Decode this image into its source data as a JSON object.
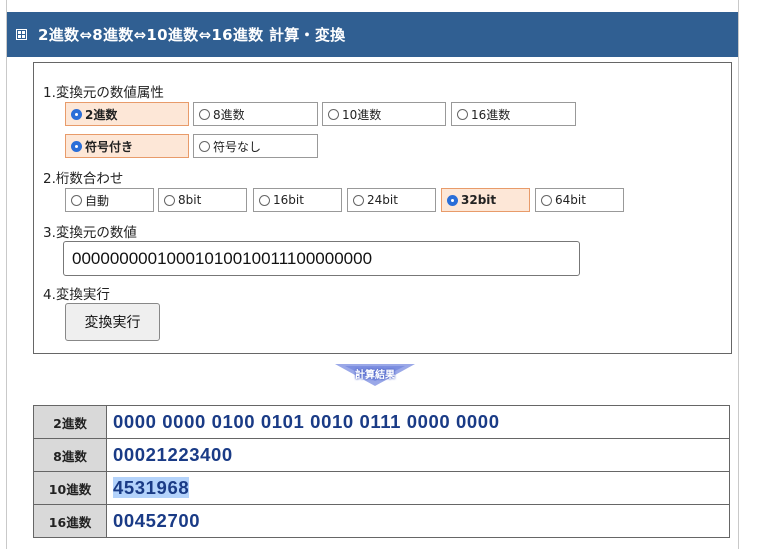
{
  "header": {
    "title": "2進数⇔8進数⇔10進数⇔16進数 計算・変換"
  },
  "form": {
    "step1": {
      "label": "1.変換元の数値属性",
      "base_options": [
        {
          "label": "2進数",
          "selected": true
        },
        {
          "label": "8進数",
          "selected": false
        },
        {
          "label": "10進数",
          "selected": false
        },
        {
          "label": "16進数",
          "selected": false
        }
      ],
      "sign_options": [
        {
          "label": "符号付き",
          "selected": true
        },
        {
          "label": "符号なし",
          "selected": false
        }
      ]
    },
    "step2": {
      "label": "2.桁数合わせ",
      "digit_options": [
        {
          "label": "自動",
          "selected": false
        },
        {
          "label": "8bit",
          "selected": false
        },
        {
          "label": "16bit",
          "selected": false
        },
        {
          "label": "24bit",
          "selected": false
        },
        {
          "label": "32bit",
          "selected": true
        },
        {
          "label": "64bit",
          "selected": false
        }
      ]
    },
    "step3": {
      "label": "3.変換元の数値",
      "value": "00000000010001010010011100000000"
    },
    "step4": {
      "label": "4.変換実行",
      "button_label": "変換実行"
    }
  },
  "result_badge": "計算結果",
  "results": [
    {
      "base": "2進数",
      "value": "0000 0000 0100 0101 0010 0111 0000 0000"
    },
    {
      "base": "8進数",
      "value": "00021223400"
    },
    {
      "base": "10進数",
      "value": "4531968"
    },
    {
      "base": "16進数",
      "value": "00452700"
    }
  ],
  "colors": {
    "title_bar": "#305f92",
    "selected_option_bg": "#fde7d7",
    "result_value_text": "#1a3b86",
    "text_selection": "#b4d3fb"
  }
}
